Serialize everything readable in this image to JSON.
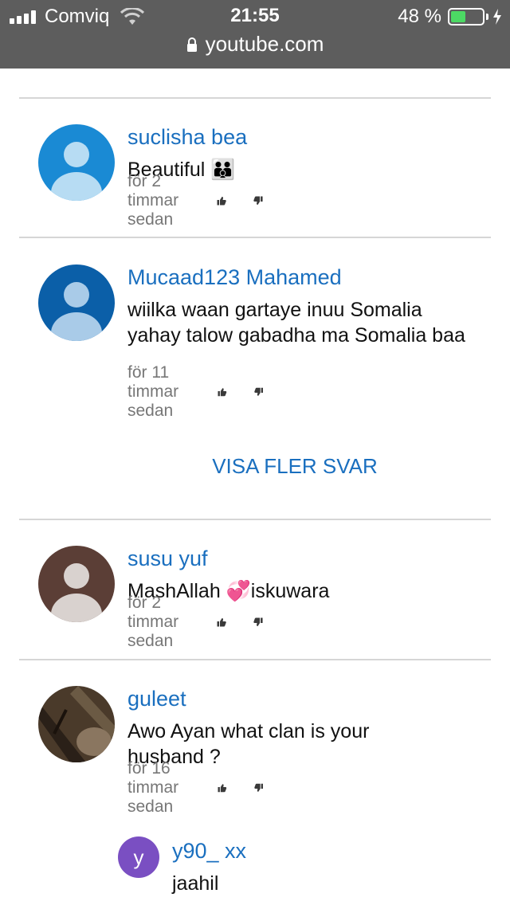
{
  "status_bar": {
    "carrier": "Comviq",
    "time": "21:55",
    "battery": "48 %",
    "battery_level": 0.48,
    "url": "youtube.com"
  },
  "comments": [
    {
      "author": "suclisha bea",
      "text": "Beautiful 👪",
      "time_ago": "för 2 timmar sedan",
      "avatar_color": "#1a8ad4"
    },
    {
      "author": "Mucaad123 Mahamed",
      "text": "wiilka waan gartaye inuu Somalia yahay talow gabadha ma Somalia baa",
      "time_ago": "för 11 timmar sedan",
      "avatar_color": "#0b5fa8"
    },
    {
      "author": "susu yuf",
      "text": "MashAllah 💞iskuwara",
      "time_ago": "för 2 timmar sedan",
      "avatar_color": "#5b3e36"
    },
    {
      "author": "guleet",
      "text": "Awo Ayan what clan is your husband ?",
      "time_ago": "för 16 timmar sedan",
      "avatar_color": "#4a3a2a"
    }
  ],
  "more_replies": "VISA FLER SVAR",
  "reply": {
    "avatar_letter": "y",
    "author": "y90_ xx",
    "text": "jaahil",
    "avatar_color": "#7a4fc2"
  },
  "icons": {
    "like": "thumbs-up-icon",
    "dislike": "thumbs-down-icon"
  }
}
